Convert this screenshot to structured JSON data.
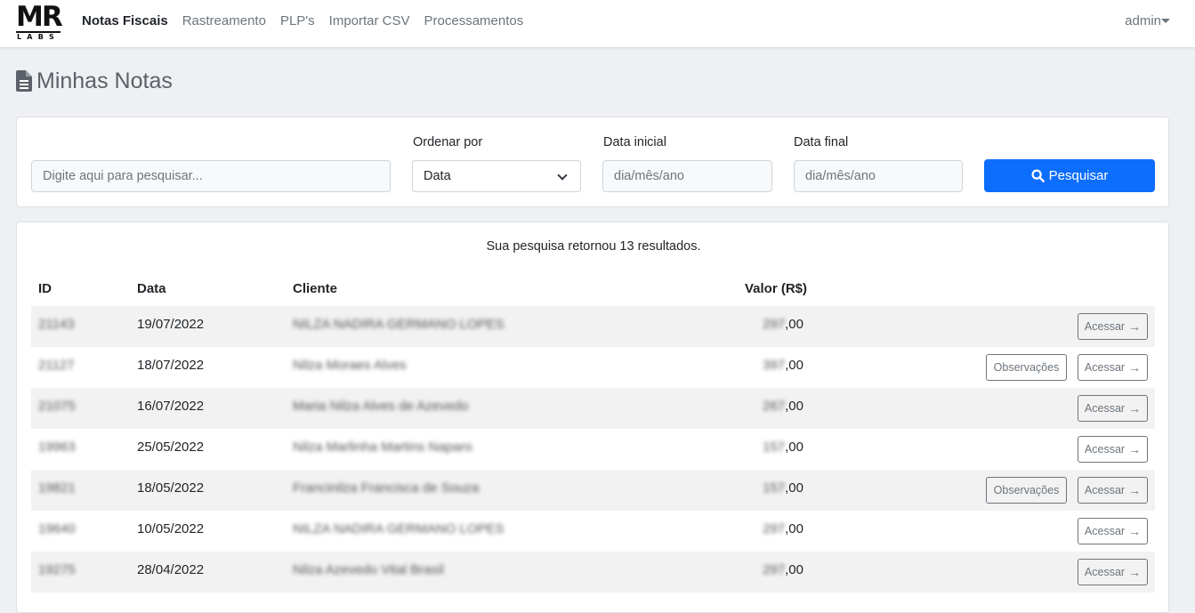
{
  "navbar": {
    "logo_main": "MR",
    "logo_sub": "LABS",
    "links": [
      "Notas Fiscais",
      "Rastreamento",
      "PLP's",
      "Importar CSV",
      "Processamentos"
    ],
    "active_link": "Notas Fiscais",
    "user": "admin"
  },
  "page": {
    "title": "Minhas Notas"
  },
  "search": {
    "placeholder": "Digite aqui para pesquisar...",
    "order_label": "Ordenar por",
    "order_value": "Data",
    "start_label": "Data inicial",
    "start_placeholder": "dia/mês/ano",
    "end_label": "Data final",
    "end_placeholder": "dia/mês/ano",
    "button_label": "Pesquisar"
  },
  "results": {
    "summary": "Sua pesquisa retornou 13 resultados.",
    "columns": {
      "id": "ID",
      "date": "Data",
      "client": "Cliente",
      "value": "Valor (R$)"
    },
    "access_label": "Acessar",
    "obs_label": "Observações",
    "rows": [
      {
        "id": "21143",
        "date": "19/07/2022",
        "client": "NILZA NADIRA GERMANO LOPES",
        "value_int": "297",
        "value_dec": ",00"
      },
      {
        "id": "21127",
        "date": "18/07/2022",
        "client": "Nilza Moraes Alves",
        "value_int": "397",
        "value_dec": ",00"
      },
      {
        "id": "21075",
        "date": "16/07/2022",
        "client": "Maria Nilza Alves de Azevedo",
        "value_int": "267",
        "value_dec": ",00"
      },
      {
        "id": "19963",
        "date": "25/05/2022",
        "client": "Nilza Marlinha Martins Naparo",
        "value_int": "157",
        "value_dec": ",00"
      },
      {
        "id": "19821",
        "date": "18/05/2022",
        "client": "Francinilza Francisca de Souza",
        "value_int": "157",
        "value_dec": ",00"
      },
      {
        "id": "19640",
        "date": "10/05/2022",
        "client": "NILZA NADIRA GERMANO LOPES",
        "value_int": "297",
        "value_dec": ",00"
      },
      {
        "id": "19275",
        "date": "28/04/2022",
        "client": "Nilza Azevedo Vital Brasil",
        "value_int": "297",
        "value_dec": ",00"
      }
    ]
  }
}
